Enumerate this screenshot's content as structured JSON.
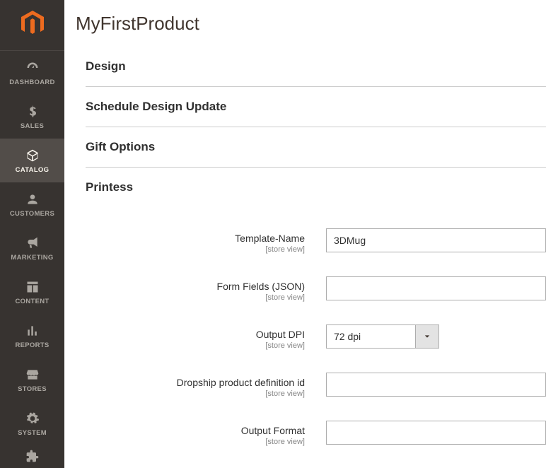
{
  "sidebar": {
    "items": [
      {
        "label": "DASHBOARD",
        "icon": "dashboard-icon"
      },
      {
        "label": "SALES",
        "icon": "dollar-icon"
      },
      {
        "label": "CATALOG",
        "icon": "cube-icon",
        "active": true
      },
      {
        "label": "CUSTOMERS",
        "icon": "person-icon"
      },
      {
        "label": "MARKETING",
        "icon": "megaphone-icon"
      },
      {
        "label": "CONTENT",
        "icon": "layout-icon"
      },
      {
        "label": "REPORTS",
        "icon": "bars-icon"
      },
      {
        "label": "STORES",
        "icon": "storefront-icon"
      },
      {
        "label": "SYSTEM",
        "icon": "gear-icon"
      }
    ]
  },
  "page": {
    "title": "MyFirstProduct"
  },
  "sections": {
    "design": "Design",
    "schedule": "Schedule Design Update",
    "gift": "Gift Options",
    "printess": "Printess"
  },
  "scope_label": "[store view]",
  "fields": {
    "template_name": {
      "label": "Template-Name",
      "value": "3DMug"
    },
    "form_fields": {
      "label": "Form Fields (JSON)",
      "value": ""
    },
    "output_dpi": {
      "label": "Output DPI",
      "selected": "72 dpi"
    },
    "dropship": {
      "label": "Dropship product definition id",
      "value": ""
    },
    "output_format": {
      "label": "Output Format",
      "value": ""
    }
  }
}
